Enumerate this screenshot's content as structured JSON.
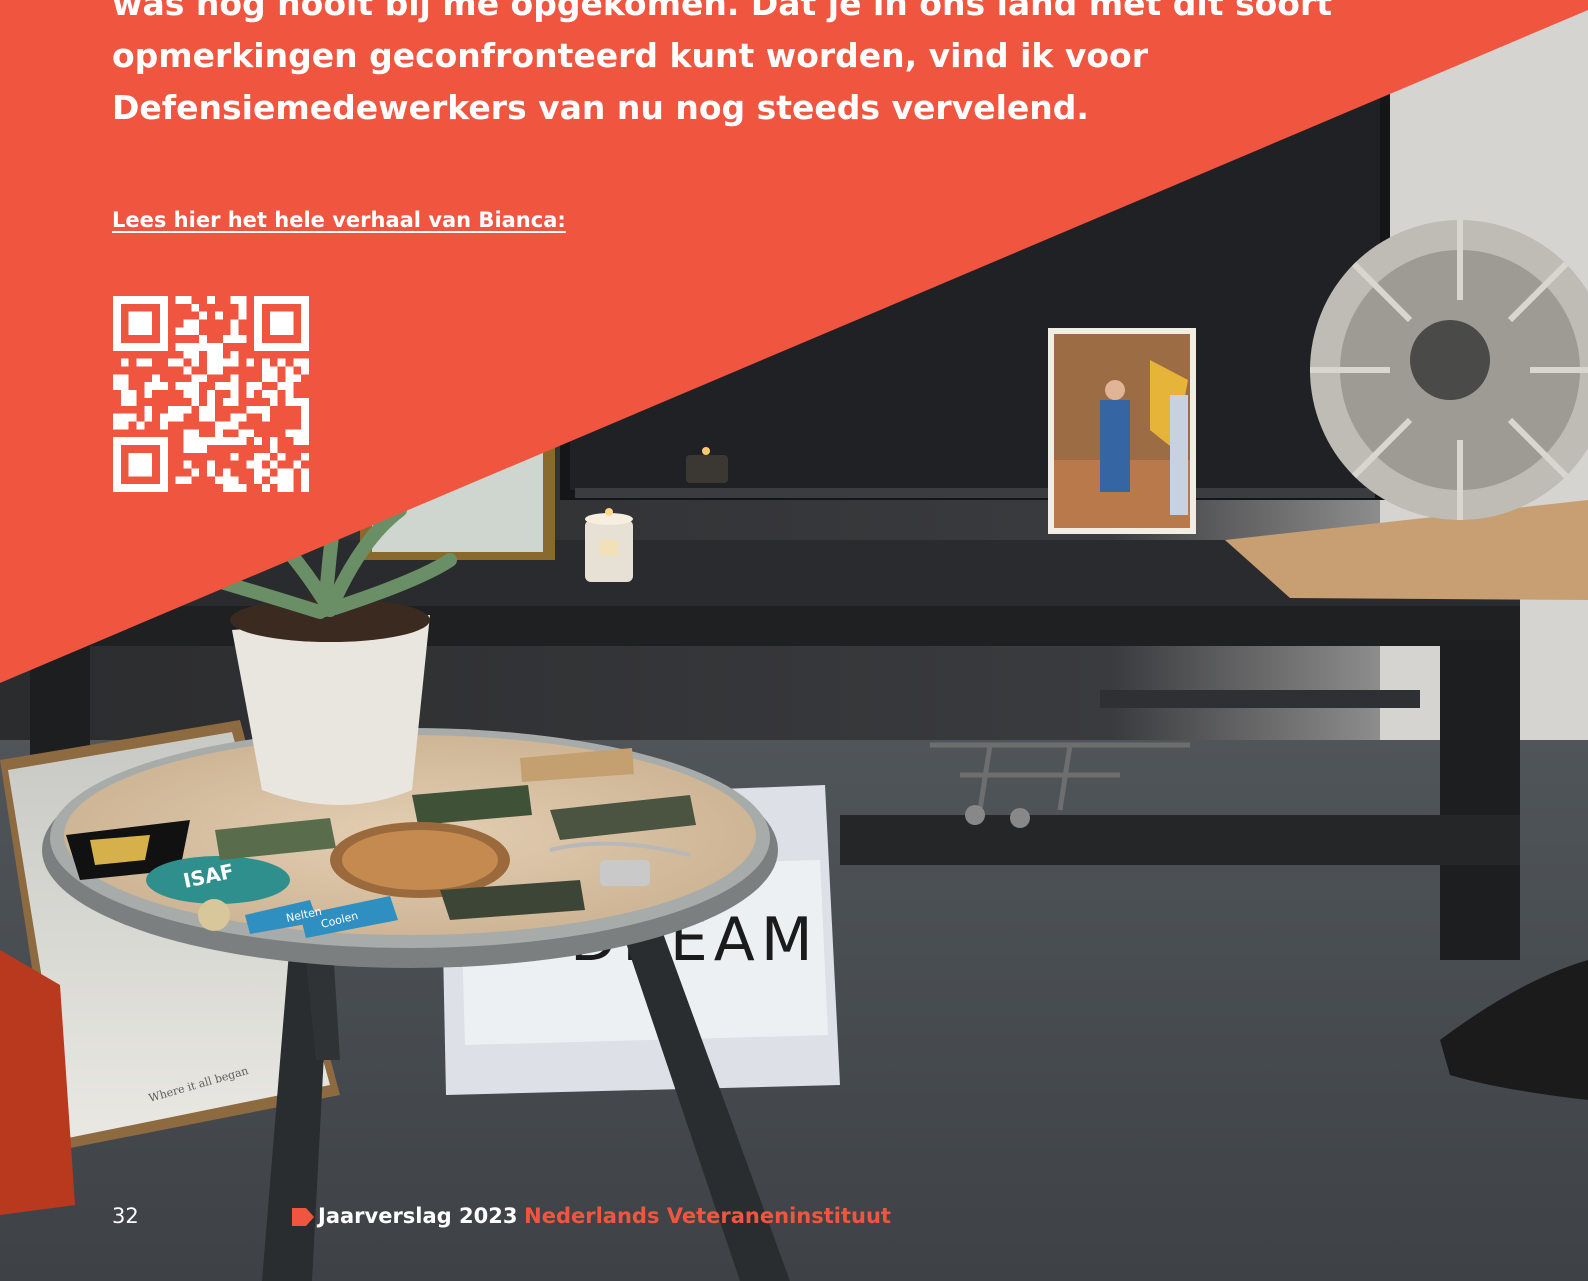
{
  "colors": {
    "accent": "#f05540",
    "text_light": "#ffffff"
  },
  "quote": {
    "lines": [
      "was nog nooit bij me opgekomen. Dat je in ons land met dit soort",
      "opmerkingen geconfronteerd kunt worden, vind ik voor",
      "Defensiemedewerkers van nu nog steeds vervelend."
    ]
  },
  "link": {
    "label": "Lees hier het hele verhaal van Bianca:"
  },
  "qr": {
    "icon": "qr-code-icon"
  },
  "photo": {
    "lightbox_text": "DREAM",
    "map_caption": "Where it all began",
    "name_tags": [
      "Nelten",
      "Coolen"
    ],
    "patch_text": "ISAF"
  },
  "footer": {
    "page_number": "32",
    "icon": "tag-icon",
    "title": "Jaarverslag 2023",
    "organization": "Nederlands Veteraneninstituut"
  }
}
